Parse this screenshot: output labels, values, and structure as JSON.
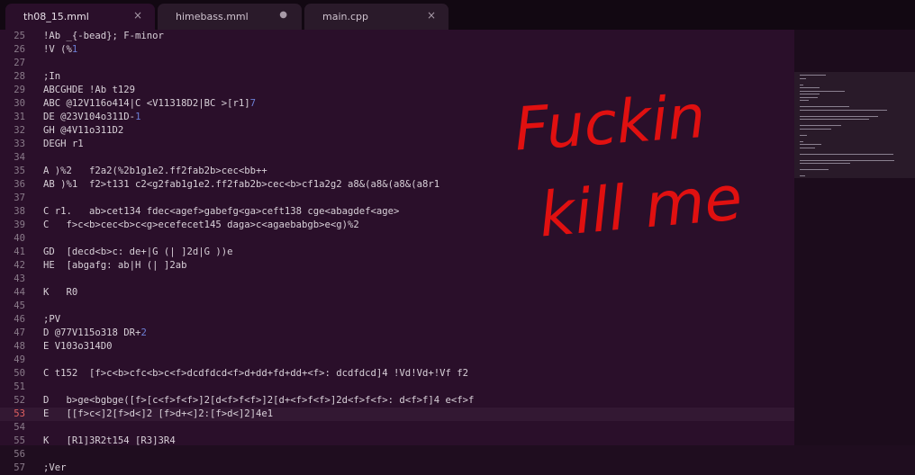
{
  "tabs": [
    {
      "label": "th08_15.mml",
      "active": true,
      "close_icon": "×"
    },
    {
      "label": "himebass.mml",
      "active": false,
      "dirty_icon": "●"
    },
    {
      "label": "main.cpp",
      "active": false,
      "close_icon": "×"
    }
  ],
  "editor": {
    "current_line": "53",
    "lines": [
      {
        "n": "25",
        "text": "!Ab _{-bead}; F-minor"
      },
      {
        "n": "26",
        "text": "!V (%",
        "tail_num": "1"
      },
      {
        "n": "27",
        "text": ""
      },
      {
        "n": "28",
        "text": ";In"
      },
      {
        "n": "29",
        "text": "ABCGHDE !Ab t129"
      },
      {
        "n": "30",
        "text": "ABC @12V116o414|C <V11318D2|BC >[r1]",
        "tail_num": "7"
      },
      {
        "n": "31",
        "text": "DE @23V104o311D-",
        "tail_num": "1"
      },
      {
        "n": "32",
        "text": "GH @4V11o311D2"
      },
      {
        "n": "33",
        "text": "DEGH r1"
      },
      {
        "n": "34",
        "text": ""
      },
      {
        "n": "35",
        "text": "A )%2   f2a2(%2b1g1e2.ff2fab2b>cec<bb++"
      },
      {
        "n": "36",
        "text": "AB )%1  f2>t131 c2<g2fab1g1e2.ff2fab2b>cec<b>cf1a2g2 a8&(a8&(a8&(a8r1"
      },
      {
        "n": "37",
        "text": ""
      },
      {
        "n": "38",
        "text": "C r1.   ab>cet134 fdec<agef>gabefg<ga>ceft138 cge<abagdef<age>"
      },
      {
        "n": "39",
        "text": "C   f>c<b>cec<b>c<g>ecefecet145 daga>c<agaebabgb>e<g)%2"
      },
      {
        "n": "40",
        "text": ""
      },
      {
        "n": "41",
        "text": "GD  [decd<b>c: de+|G (| ]2d|G ))e"
      },
      {
        "n": "42",
        "text": "HE  [abgafg: ab|H (| ]2ab"
      },
      {
        "n": "43",
        "text": ""
      },
      {
        "n": "44",
        "text": "K   R0"
      },
      {
        "n": "45",
        "text": ""
      },
      {
        "n": "46",
        "text": ";PV"
      },
      {
        "n": "47",
        "text": "D @77V115o318 DR+",
        "tail_num": "2"
      },
      {
        "n": "48",
        "text": "E V103o314D0"
      },
      {
        "n": "49",
        "text": ""
      },
      {
        "n": "50",
        "text": "C t152  [f>c<b>cfc<b>c<f>dcdfdcd<f>d+dd+fd+dd+<f>: dcdfdcd]4 !Vd!Vd+!Vf f2"
      },
      {
        "n": "51",
        "text": ""
      },
      {
        "n": "52",
        "text": "D   b>ge<bgbge([f>[c<f>f<f>]2[d<f>f<f>]2[d+<f>f<f>]2d<f>f<f>: d<f>f]4 e<f>f"
      },
      {
        "n": "53",
        "text": "E   [[f>c<]2[f>d<]2 [f>d+<]2:[f>d<]2]4e1"
      },
      {
        "n": "54",
        "text": ""
      },
      {
        "n": "55",
        "text": "K   [R1]3R2t154 [R3]3R4"
      },
      {
        "n": "56",
        "text": ""
      },
      {
        "n": "57",
        "text": ";Ver"
      }
    ]
  },
  "graffiti": {
    "line1": "Fuckin",
    "line2": "kill me",
    "color": "#e01010"
  },
  "colors": {
    "background": "#2a0f2a",
    "number": "#6c7fd6",
    "accent": "#e01010"
  }
}
